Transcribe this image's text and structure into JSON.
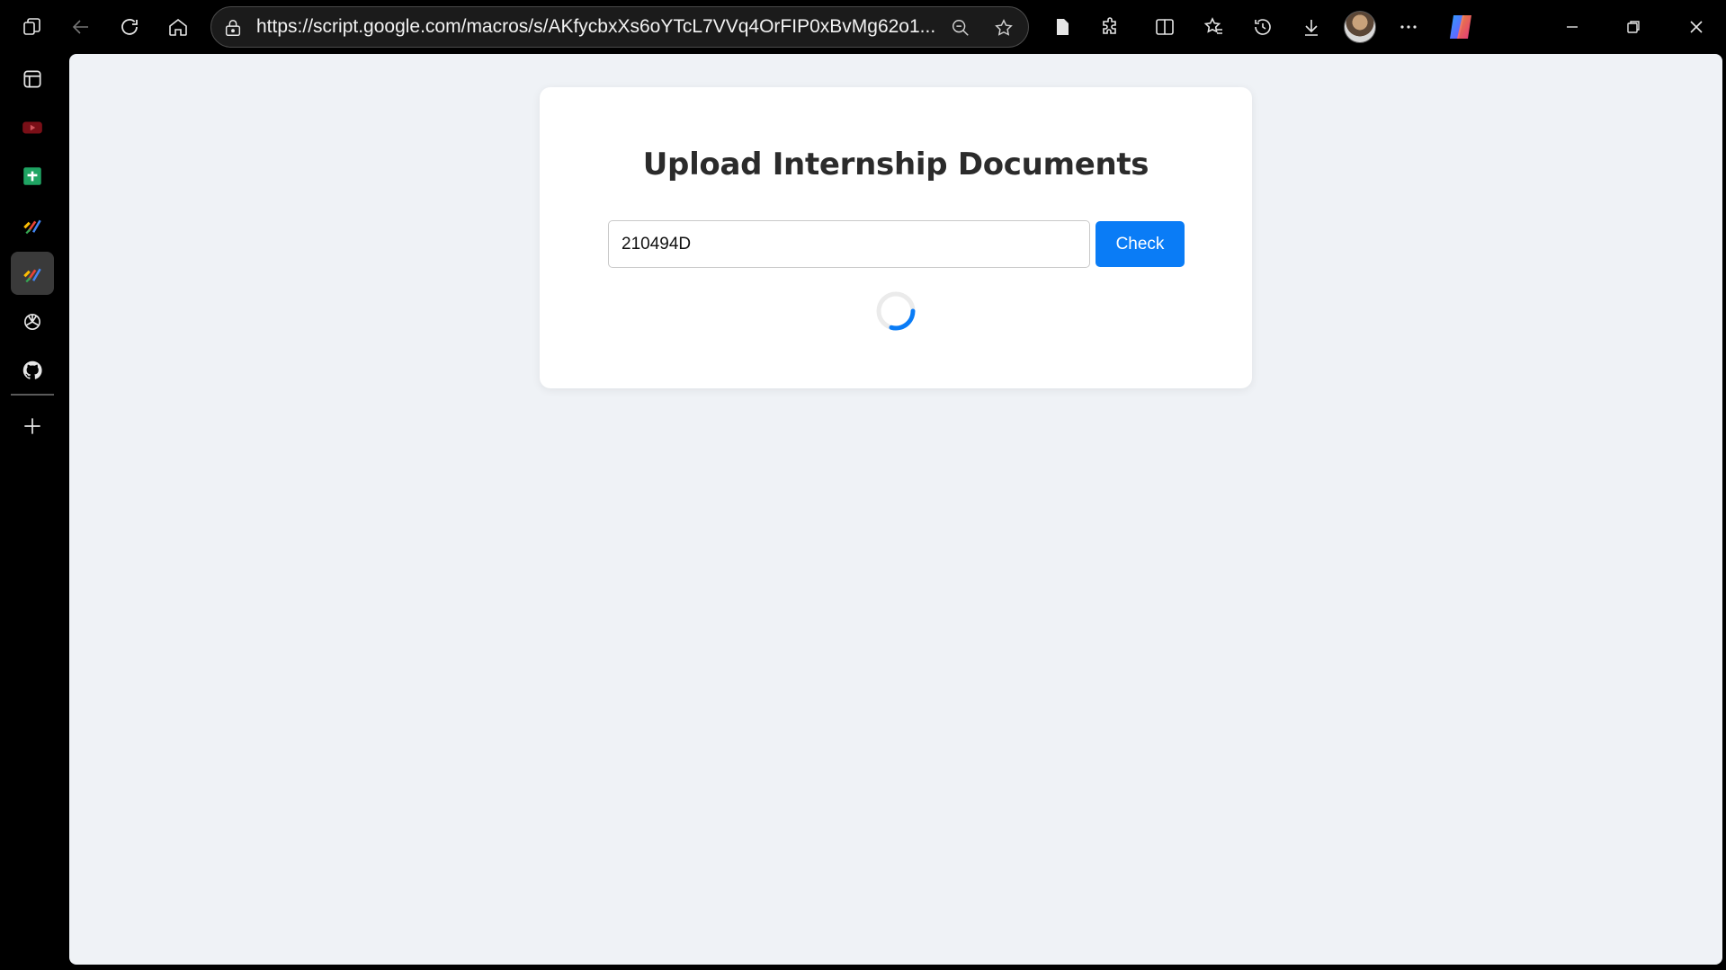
{
  "browser": {
    "url": "https://script.google.com/macros/s/AKfycbxXs6oYTcL7VVq4OrFIP0xBvMg62o1...",
    "icons": {
      "workspaces": "workspaces-icon",
      "back": "back-arrow-icon",
      "refresh": "refresh-icon",
      "home": "home-icon",
      "site_info": "lock-icon",
      "zoom": "zoom-out-icon",
      "favorite": "star-icon",
      "reading": "document-icon",
      "extensions": "puzzle-icon",
      "split_screen": "split-screen-icon",
      "favorites": "favorites-icon",
      "history": "history-icon",
      "downloads": "download-icon",
      "more": "more-icon",
      "copilot": "copilot-icon",
      "minimize": "minimize-icon",
      "restore": "restore-icon",
      "close": "close-icon"
    }
  },
  "sidebar": {
    "items": [
      {
        "name": "tab-actions",
        "icon": "tab-layout-icon"
      },
      {
        "name": "youtube",
        "icon": "youtube-icon"
      },
      {
        "name": "google-sheets",
        "icon": "sheets-icon"
      },
      {
        "name": "apps-script",
        "icon": "apps-script-icon"
      },
      {
        "name": "apps-script-active",
        "icon": "apps-script-icon"
      },
      {
        "name": "chatgpt",
        "icon": "chatgpt-icon"
      },
      {
        "name": "github",
        "icon": "github-icon"
      },
      {
        "name": "add",
        "icon": "plus-icon"
      }
    ]
  },
  "page": {
    "title": "Upload Internship Documents",
    "id_input_value": "210494D",
    "check_button_label": "Check",
    "loading": true,
    "colors": {
      "page_background": "#eff2f6",
      "card_background": "#ffffff",
      "button": "#0a7cf6",
      "spinner": "#0a7cf6"
    }
  }
}
